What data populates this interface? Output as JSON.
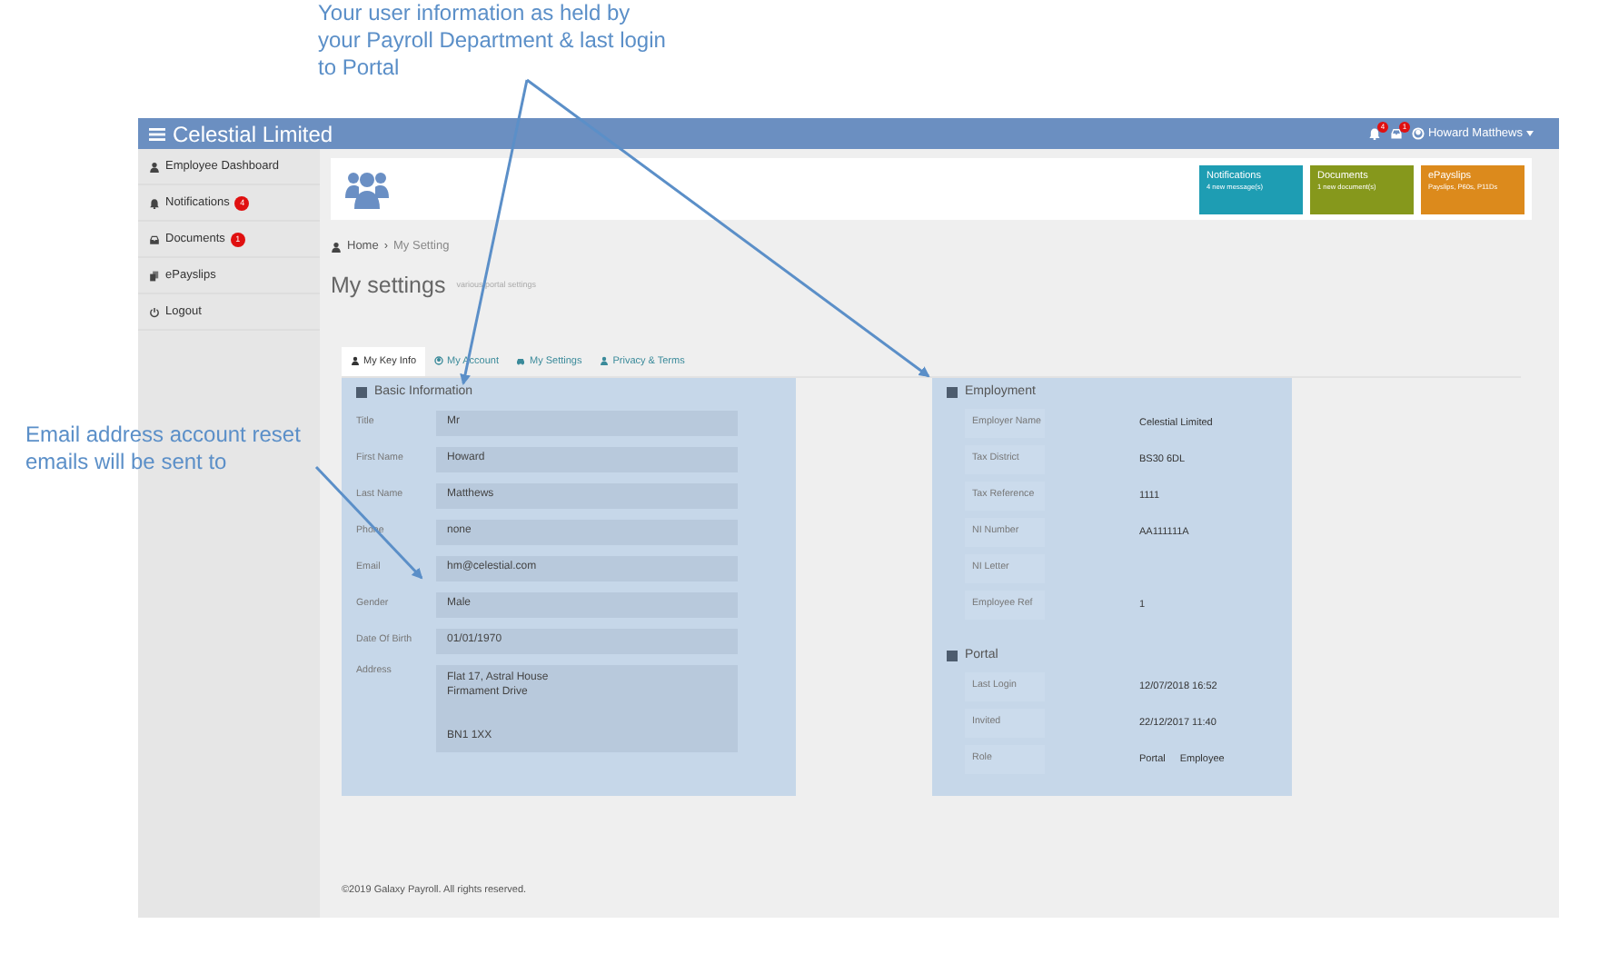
{
  "annotations": [
    {
      "kind": "top",
      "text": "Your user information as held by your Payroll Department & last login to Portal"
    },
    {
      "kind": "left",
      "text": "Email address account reset emails will be sent to"
    }
  ],
  "navbar": {
    "title": "Celestial Limited",
    "alerts": [
      {
        "kind": "bell",
        "count": "4"
      },
      {
        "kind": "inbox",
        "count": "1"
      }
    ],
    "user": "Howard Matthews"
  },
  "sidebar": {
    "items": [
      {
        "kind": "person",
        "label": "Employee Dashboard"
      },
      {
        "kind": "bell",
        "label": "Notifications",
        "badge": "4"
      },
      {
        "kind": "inbox",
        "label": "Documents",
        "badge": "1"
      },
      {
        "kind": "files",
        "label": "ePayslips"
      },
      {
        "kind": "power",
        "label": "Logout"
      }
    ]
  },
  "tiles": [
    {
      "title": "Notifications",
      "subtitle": "4 new message(s)",
      "color": "#1e9db3"
    },
    {
      "title": "Documents",
      "subtitle": "1 new document(s)",
      "color": "#86981c"
    },
    {
      "title": "ePayslips",
      "subtitle": "Payslips, P60s, P11Ds",
      "color": "#dc8a1c"
    }
  ],
  "breadcrumb": [
    "Home",
    "My Setting"
  ],
  "breadcrumb_separator": "›",
  "page": {
    "title": "My settings",
    "subtitle": "various portal settings"
  },
  "tabs": [
    {
      "kind": "person",
      "label": "My Key Info",
      "selected": true
    },
    {
      "kind": "account",
      "label": "My Account",
      "selected": false
    },
    {
      "kind": "car",
      "label": "My Settings",
      "selected": false
    },
    {
      "kind": "person",
      "label": "Privacy & Terms",
      "selected": false
    }
  ],
  "basic_information": {
    "title": "Basic Information",
    "fields": [
      {
        "label": "Title",
        "value": "Mr"
      },
      {
        "label": "First Name",
        "value": "Howard"
      },
      {
        "label": "Last Name",
        "value": "Matthews"
      },
      {
        "label": "Phone",
        "value": "none"
      },
      {
        "label": "Email",
        "value": "hm@celestial.com"
      },
      {
        "label": "Gender",
        "value": "Male"
      },
      {
        "label": "Date Of Birth",
        "value": "01/01/1970"
      },
      {
        "label": "Address",
        "kind": "multiline",
        "value": "Flat 17, Astral House\nFirmament Drive\n\n\nBN1 1XX"
      }
    ]
  },
  "employment": {
    "title": "Employment",
    "rows": [
      {
        "label": "Employer Name",
        "value": [
          "Celestial Limited"
        ]
      },
      {
        "label": "Tax District",
        "value": [
          "BS30 6DL"
        ]
      },
      {
        "label": "Tax Reference",
        "value": [
          "1111"
        ]
      },
      {
        "label": "NI Number",
        "value": [
          "AA111111A"
        ]
      },
      {
        "label": "NI Letter",
        "value": []
      },
      {
        "label": "Employee Ref",
        "value": [
          "1"
        ]
      }
    ]
  },
  "portal": {
    "title": "Portal",
    "rows": [
      {
        "label": "Last Login",
        "value": [
          "12/07/2018 16:52"
        ]
      },
      {
        "label": "Invited",
        "value": [
          "22/12/2017 11:40"
        ]
      },
      {
        "label": "Role",
        "value": [
          "Portal",
          "Employee"
        ]
      }
    ]
  },
  "footer": "©2019 Galaxy Payroll. All rights reserved."
}
